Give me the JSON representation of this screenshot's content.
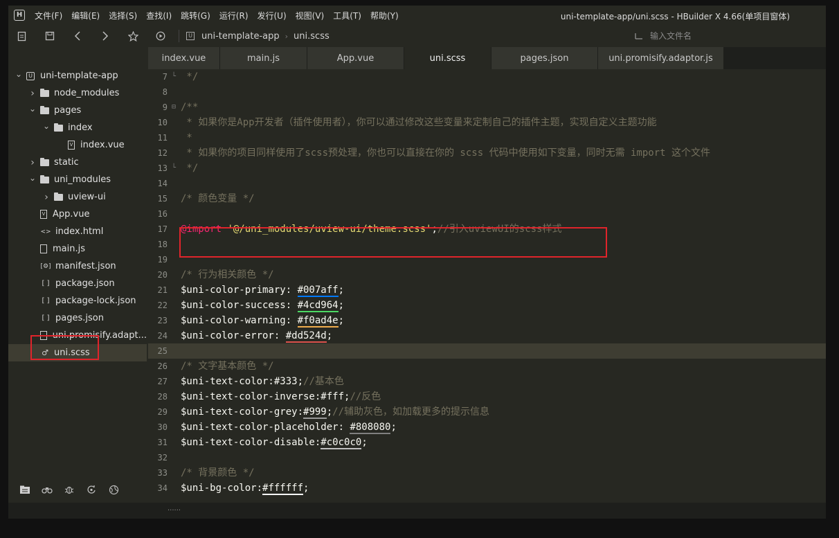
{
  "app": {
    "logo": "H",
    "title": "uni-template-app/uni.scss - HBuilder X 4.66(单项目窗体)"
  },
  "menu": [
    "文件(F)",
    "编辑(E)",
    "选择(S)",
    "查找(I)",
    "跳转(G)",
    "运行(R)",
    "发行(U)",
    "视图(V)",
    "工具(T)",
    "帮助(Y)"
  ],
  "toolbar": {
    "icons": [
      "new-file-icon",
      "save-icon",
      "back-arrow-icon",
      "forward-arrow-icon",
      "star-icon",
      "run-icon"
    ],
    "breadcrumb": [
      "uni-template-app",
      "uni.scss"
    ],
    "search_placeholder": "输入文件名"
  },
  "tree": [
    {
      "label": "uni-template-app",
      "type": "project",
      "depth": 0,
      "expanded": true
    },
    {
      "label": "node_modules",
      "type": "folder",
      "depth": 1,
      "expanded": false
    },
    {
      "label": "pages",
      "type": "folder-open",
      "depth": 1,
      "expanded": true
    },
    {
      "label": "index",
      "type": "folder-open",
      "depth": 2,
      "expanded": true
    },
    {
      "label": "index.vue",
      "type": "vue",
      "depth": 3
    },
    {
      "label": "static",
      "type": "folder",
      "depth": 1,
      "expanded": false
    },
    {
      "label": "uni_modules",
      "type": "folder-open",
      "depth": 1,
      "expanded": true
    },
    {
      "label": "uview-ui",
      "type": "folder",
      "depth": 2,
      "expanded": false
    },
    {
      "label": "App.vue",
      "type": "vue",
      "depth": 1
    },
    {
      "label": "index.html",
      "type": "html",
      "depth": 1
    },
    {
      "label": "main.js",
      "type": "js",
      "depth": 1
    },
    {
      "label": "manifest.json",
      "type": "manifest",
      "depth": 1
    },
    {
      "label": "package.json",
      "type": "json",
      "depth": 1
    },
    {
      "label": "package-lock.json",
      "type": "json",
      "depth": 1
    },
    {
      "label": "pages.json",
      "type": "json",
      "depth": 1
    },
    {
      "label": "uni.promisify.adapt...",
      "type": "js",
      "depth": 1
    },
    {
      "label": "uni.scss",
      "type": "scss",
      "depth": 1,
      "selected": true
    }
  ],
  "sidebar_bottom_icons": [
    "project-manager-icon",
    "search-binoculars-icon",
    "debug-bug-icon",
    "git-icon",
    "browser-icon"
  ],
  "tabs": [
    {
      "label": "index.vue",
      "active": false
    },
    {
      "label": "main.js",
      "active": false
    },
    {
      "label": "App.vue",
      "active": false
    },
    {
      "label": "uni.scss",
      "active": true
    },
    {
      "label": "pages.json",
      "active": false
    },
    {
      "label": "uni.promisify.adaptor.js",
      "active": false
    }
  ],
  "code_lines": [
    {
      "n": "7",
      "fold": "end",
      "segs": [
        {
          "t": " */",
          "c": "c-comment"
        }
      ]
    },
    {
      "n": "8",
      "segs": []
    },
    {
      "n": "9",
      "fold": "start",
      "segs": [
        {
          "t": "/**",
          "c": "c-comment"
        }
      ]
    },
    {
      "n": "10",
      "segs": [
        {
          "t": " * 如果你是App开发者（插件使用者），你可以通过修改这些变量来定制自己的插件主题，实现自定义主题功能",
          "c": "c-comment"
        }
      ]
    },
    {
      "n": "11",
      "segs": [
        {
          "t": " *",
          "c": "c-comment"
        }
      ]
    },
    {
      "n": "12",
      "segs": [
        {
          "t": " * 如果你的项目同样使用了scss预处理，你也可以直接在你的 scss 代码中使用如下变量，同时无需 import 这个文件",
          "c": "c-comment"
        }
      ]
    },
    {
      "n": "13",
      "fold": "end",
      "segs": [
        {
          "t": " */",
          "c": "c-comment"
        }
      ]
    },
    {
      "n": "14",
      "segs": []
    },
    {
      "n": "15",
      "segs": [
        {
          "t": "/* 颜色变量 */",
          "c": "c-comment"
        }
      ]
    },
    {
      "n": "16",
      "segs": []
    },
    {
      "n": "17",
      "segs": [
        {
          "t": "@import",
          "c": "c-at"
        },
        {
          "t": " ",
          "c": "c-plain"
        },
        {
          "t": "'@/uni_modules/uview-ui/theme.scss'",
          "c": "c-str"
        },
        {
          "t": ";",
          "c": "c-plain"
        },
        {
          "t": "//引入uviewUI的scss样式",
          "c": "c-comment"
        }
      ]
    },
    {
      "n": "18",
      "segs": []
    },
    {
      "n": "19",
      "segs": []
    },
    {
      "n": "20",
      "segs": [
        {
          "t": "/* 行为相关颜色 */",
          "c": "c-comment"
        }
      ]
    },
    {
      "n": "21",
      "segs": [
        {
          "t": "$uni-color-primary: ",
          "c": "c-var"
        },
        {
          "t": "#007aff",
          "c": "c-var",
          "u": "#007aff"
        },
        {
          "t": ";",
          "c": "c-plain"
        }
      ]
    },
    {
      "n": "22",
      "segs": [
        {
          "t": "$uni-color-success: ",
          "c": "c-var"
        },
        {
          "t": "#4cd964",
          "c": "c-var",
          "u": "#4cd964"
        },
        {
          "t": ";",
          "c": "c-plain"
        }
      ]
    },
    {
      "n": "23",
      "segs": [
        {
          "t": "$uni-color-warning: ",
          "c": "c-var"
        },
        {
          "t": "#f0ad4e",
          "c": "c-var",
          "u": "#f0ad4e"
        },
        {
          "t": ";",
          "c": "c-plain"
        }
      ]
    },
    {
      "n": "24",
      "segs": [
        {
          "t": "$uni-color-error: ",
          "c": "c-var"
        },
        {
          "t": "#dd524d",
          "c": "c-var",
          "u": "#dd524d"
        },
        {
          "t": ";",
          "c": "c-plain"
        }
      ]
    },
    {
      "n": "25",
      "current": true,
      "segs": []
    },
    {
      "n": "26",
      "segs": [
        {
          "t": "/* 文字基本颜色 */",
          "c": "c-comment"
        }
      ]
    },
    {
      "n": "27",
      "segs": [
        {
          "t": "$uni-text-color:#333;",
          "c": "c-var"
        },
        {
          "t": "//基本色",
          "c": "c-comment"
        }
      ]
    },
    {
      "n": "28",
      "segs": [
        {
          "t": "$uni-text-color-inverse:#fff;",
          "c": "c-var"
        },
        {
          "t": "//反色",
          "c": "c-comment"
        }
      ]
    },
    {
      "n": "29",
      "segs": [
        {
          "t": "$uni-text-color-grey:",
          "c": "c-var"
        },
        {
          "t": "#999",
          "c": "c-var",
          "u": "#999999"
        },
        {
          "t": ";",
          "c": "c-plain"
        },
        {
          "t": "//辅助灰色，如加载更多的提示信息",
          "c": "c-comment"
        }
      ]
    },
    {
      "n": "30",
      "segs": [
        {
          "t": "$uni-text-color-placeholder: ",
          "c": "c-var"
        },
        {
          "t": "#808080",
          "c": "c-var",
          "u": "#808080"
        },
        {
          "t": ";",
          "c": "c-plain"
        }
      ]
    },
    {
      "n": "31",
      "segs": [
        {
          "t": "$uni-text-color-disable:",
          "c": "c-var"
        },
        {
          "t": "#c0c0c0",
          "c": "c-var",
          "u": "#c0c0c0"
        },
        {
          "t": ";",
          "c": "c-plain"
        }
      ]
    },
    {
      "n": "32",
      "segs": []
    },
    {
      "n": "33",
      "segs": [
        {
          "t": "/* 背景颜色 */",
          "c": "c-comment"
        }
      ]
    },
    {
      "n": "34",
      "segs": [
        {
          "t": "$uni-bg-color:",
          "c": "c-var"
        },
        {
          "t": "#ffffff",
          "c": "c-var",
          "u": "#ffffff"
        },
        {
          "t": ";",
          "c": "c-plain"
        }
      ]
    }
  ],
  "colors": {
    "highlight_box": "#e0242b",
    "editor_bg": "#272822"
  }
}
